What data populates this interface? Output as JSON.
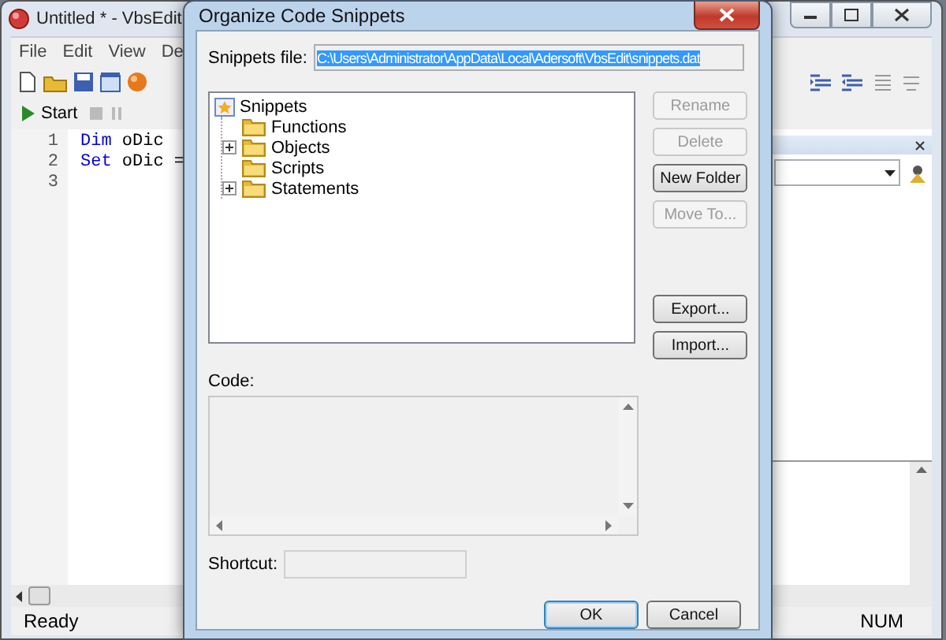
{
  "app": {
    "title": "Untitled * - VbsEdit",
    "menu": [
      "File",
      "Edit",
      "View",
      "De"
    ],
    "run_button": "Start",
    "lines": [
      {
        "number": "1",
        "keyword": "Dim",
        "rest": "oDic"
      },
      {
        "number": "2",
        "keyword": "Set",
        "rest": "oDic ="
      },
      {
        "number": "3"
      }
    ],
    "status": "Ready",
    "indicator": "NUM"
  },
  "dialog": {
    "title": "Organize Code Snippets",
    "file_label": "Snippets file:",
    "file_path": "C:\\Users\\Administrator\\AppData\\Local\\Adersoft\\VbsEdit\\snippets.dat",
    "tree": {
      "label": "Snippets",
      "children": [
        {
          "label": "Functions",
          "expandable": false
        },
        {
          "label": "Objects",
          "expandable": true
        },
        {
          "label": "Scripts",
          "expandable": false
        },
        {
          "label": "Statements",
          "expandable": true
        }
      ]
    },
    "buttons": [
      {
        "label": "Rename",
        "disabled": true
      },
      {
        "label": "Delete",
        "disabled": true
      },
      {
        "label": "New Folder",
        "disabled": false
      },
      {
        "label": "Move To...",
        "disabled": true
      }
    ],
    "transfer_buttons": [
      {
        "label": "Export...",
        "disabled": false
      },
      {
        "label": "Import...",
        "disabled": false
      }
    ],
    "code_label": "Code:",
    "shortcut_label": "Shortcut:",
    "footer_buttons": [
      {
        "label": "OK",
        "default": true
      },
      {
        "label": "Cancel",
        "default": false
      }
    ]
  }
}
